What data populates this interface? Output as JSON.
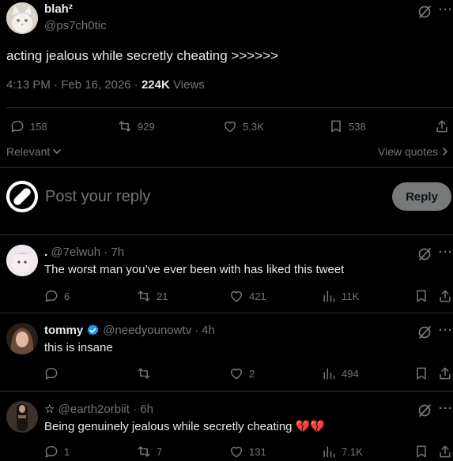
{
  "main_tweet": {
    "display_name": "blah²",
    "handle": "@ps7ch0tic",
    "text": "acting jealous while secretly cheating >>>>>>",
    "time": "4:13 PM",
    "date": "Feb 16, 2026",
    "views_count": "224K",
    "views_label": "Views",
    "replies": "158",
    "reposts": "929",
    "likes": "5.3K",
    "bookmarks": "538"
  },
  "sort": {
    "label": "Relevant",
    "view_quotes": "View quotes"
  },
  "composer": {
    "placeholder": "Post your reply",
    "reply_button": "Reply"
  },
  "replies": [
    {
      "display_name": "",
      "handle": "@7elwuh",
      "time": "7h",
      "text": "The worst man you’ve ever been with has liked this tweet",
      "replies": "6",
      "reposts": "21",
      "likes": "421",
      "views": "11K"
    },
    {
      "display_name": "tommy",
      "handle": "@needyounowtv",
      "time": "4h",
      "text": "this is insane",
      "replies": "",
      "reposts": "",
      "likes": "2",
      "views": "494"
    },
    {
      "display_name": "",
      "handle": "@earth2orbiit",
      "time": "6h",
      "text": "Being genuinely jealous while secretly cheating",
      "emoji": "💔💔",
      "replies": "1",
      "reposts": "7",
      "likes": "131",
      "views": "7.1K"
    }
  ],
  "colors": {
    "background": "#000000",
    "text": "#e7e9ea",
    "muted": "#71767b",
    "border": "#2f3336",
    "verified": "#1d9bf0",
    "heart_emoji": "#e0245e",
    "reply_button_bg": "#787a7a"
  }
}
